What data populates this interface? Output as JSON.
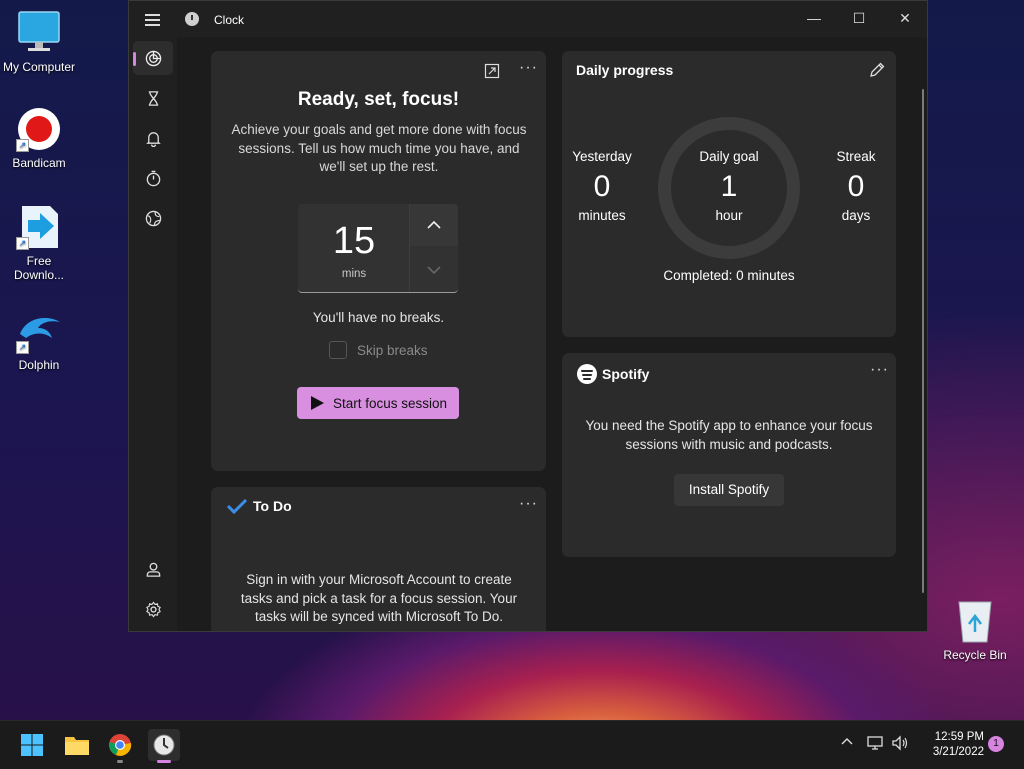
{
  "desktop": {
    "icons": [
      {
        "label": "My Computer"
      },
      {
        "label": "Bandicam"
      },
      {
        "label": "Free Downlo..."
      },
      {
        "label": "Dolphin"
      },
      {
        "label": "Recycle Bin"
      }
    ]
  },
  "window": {
    "title": "Clock",
    "buttons": {
      "minimize": "—",
      "maximize": "☐",
      "close": "✕"
    }
  },
  "nav": {
    "items": [
      {
        "icon": "focus-sessions-icon",
        "active": true
      },
      {
        "icon": "timer-hourglass-icon"
      },
      {
        "icon": "alarm-bell-icon"
      },
      {
        "icon": "stopwatch-icon"
      },
      {
        "icon": "world-clock-icon"
      }
    ],
    "bottom": [
      {
        "icon": "account-icon"
      },
      {
        "icon": "settings-icon"
      }
    ]
  },
  "focus": {
    "title": "Ready, set, focus!",
    "description": "Achieve your goals and get more done with focus sessions. Tell us how much time you have, and we'll set up the rest.",
    "minutes": "15",
    "unit": "mins",
    "breaks": "You'll have no breaks.",
    "skip_label": "Skip breaks",
    "start_label": "Start focus session",
    "menu": "···"
  },
  "progress": {
    "title": "Daily progress",
    "yesterday": {
      "label": "Yesterday",
      "value": "0",
      "unit": "minutes"
    },
    "goal": {
      "label": "Daily goal",
      "value": "1",
      "unit": "hour"
    },
    "streak": {
      "label": "Streak",
      "value": "0",
      "unit": "days"
    },
    "completed": "Completed: 0 minutes",
    "goal_progress": 0
  },
  "spotify": {
    "brand": "Spotify",
    "message": "You need the Spotify app to enhance your focus sessions with music and podcasts.",
    "button": "Install Spotify",
    "menu": "···"
  },
  "todo": {
    "title": "To Do",
    "message": "Sign in with your Microsoft Account to create tasks and pick a task for a focus session. Your tasks will be synced with Microsoft To Do.",
    "menu": "···"
  },
  "taskbar": {
    "time": "12:59 PM",
    "date": "3/21/2022",
    "notifications": "1"
  },
  "colors": {
    "accent": "#d98fe0",
    "window_bg": "#202020",
    "card_bg": "#2b2b2b"
  }
}
